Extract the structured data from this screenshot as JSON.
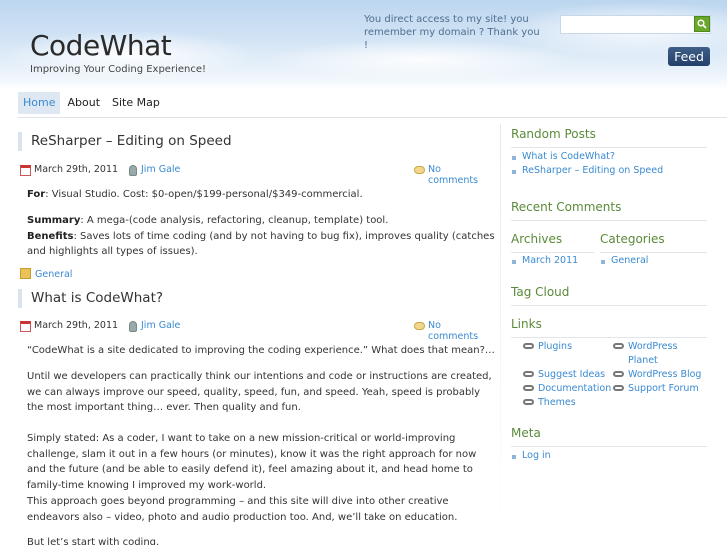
{
  "header": {
    "site_title": "CodeWhat",
    "tagline": "Improving Your Coding Experience!",
    "note": "You direct access to my site! you remember my domain ? Thank you !",
    "search_value": "",
    "feed_label": "Feed"
  },
  "nav": {
    "items": [
      {
        "label": "Home",
        "active": true
      },
      {
        "label": "About",
        "active": false
      },
      {
        "label": "Site Map",
        "active": false
      }
    ]
  },
  "posts": [
    {
      "title": "ReSharper – Editing on Speed",
      "date": "March 29th, 2011",
      "author": "Jim Gale",
      "comments": "No comments",
      "for_label": "For",
      "for_text": ": Visual Studio. Cost: $0-open/$199-personal/$349-commercial.",
      "summary_label": "Summary",
      "summary_text": ": A mega-(code analysis, refactoring, cleanup, template) tool.",
      "benefits_label": "Benefits",
      "benefits_text": ": Saves lots of time coding (and by not having to bug fix), improves quality (catches and highlights all types of issues).",
      "category": "General"
    },
    {
      "title": "What is CodeWhat?",
      "date": "March 29th, 2011",
      "author": "Jim Gale",
      "comments": "No comments",
      "p1": "“CodeWhat is a site dedicated to improving the coding experience.”  What does that mean?…",
      "p2": "Until we developers can practically think our intentions and code or instructions are created, we can always improve our speed, quality, speed, fun, and speed. Yeah, speed is probably the most important thing… ever. Then quality and fun.",
      "p3": "Simply stated: As a coder, I want to take on a new mission-critical or world-improving challenge, slam it out in a few hours (or minutes), know it was the right approach for now and the future (and be able to easily defend it), feel amazing about it, and head home to family-time knowing I improved my work-world.",
      "p4": "This approach goes beyond programming – and this site will dive into other creative endeavors also – video, photo and audio production too.  And, we’ll take on education.",
      "p5": "But let’s start with coding."
    }
  ],
  "sidebar": {
    "random_posts": {
      "heading": "Random Posts",
      "items": [
        "What is CodeWhat?",
        "ReSharper – Editing on Speed"
      ]
    },
    "recent_comments": {
      "heading": "Recent Comments"
    },
    "archives": {
      "heading": "Archives",
      "items": [
        "March 2011"
      ]
    },
    "categories": {
      "heading": "Categories",
      "items": [
        "General"
      ]
    },
    "tag_cloud": {
      "heading": "Tag Cloud"
    },
    "links": {
      "heading": "Links",
      "left": [
        "Plugins",
        "Suggest Ideas",
        "Documentation",
        "Themes"
      ],
      "right": [
        "WordPress Planet",
        "WordPress Blog",
        "Support Forum"
      ]
    },
    "meta": {
      "heading": "Meta",
      "items": [
        "Log in"
      ]
    }
  }
}
